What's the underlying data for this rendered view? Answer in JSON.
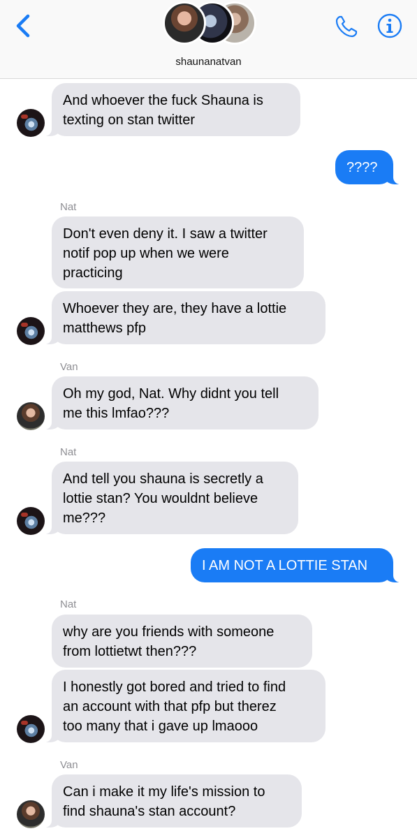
{
  "header": {
    "group_name": "shaunanatvan",
    "back_icon": "chevron-left-icon",
    "call_icon": "phone-icon",
    "details_icon": "info-icon",
    "accent": "#1a7cf5"
  },
  "colors": {
    "outgoing_bubble": "#1a7cf5",
    "incoming_bubble": "#e5e5ea",
    "sender_label": "#8e8e93"
  },
  "messages": [
    {
      "from": "Nat",
      "text": [
        "And whoever the fuck Shauna is",
        "texting on stan twitter"
      ]
    },
    {
      "from": "me",
      "text": [
        "????"
      ]
    },
    {
      "sender_label": "Nat"
    },
    {
      "from": "Nat",
      "text": [
        "Don't even deny it. I saw a twitter",
        "notif pop up when we were",
        "practicing"
      ]
    },
    {
      "from": "Nat",
      "text": [
        "Whoever they are, they have a lottie",
        "matthews pfp"
      ]
    },
    {
      "sender_label": "Van"
    },
    {
      "from": "Van",
      "text": [
        "Oh my god, Nat. Why didnt you tell",
        "me this lmfao???"
      ]
    },
    {
      "sender_label": "Nat"
    },
    {
      "from": "Nat",
      "text": [
        "And tell you shauna is secretly a",
        "lottie stan? You wouldnt believe",
        "me???"
      ]
    },
    {
      "from": "me",
      "text": [
        "I AM NOT A LOTTIE STAN"
      ]
    },
    {
      "sender_label": "Nat"
    },
    {
      "from": "Nat",
      "text": [
        "why are you friends with someone",
        "from lottietwt then???"
      ]
    },
    {
      "from": "Nat",
      "text": [
        "I honestly got bored and tried to find",
        "an account with that pfp but therez",
        "too many that i gave up lmaooo"
      ]
    },
    {
      "sender_label": "Van"
    },
    {
      "from": "Van",
      "text": [
        "Can i make it my life's mission to",
        "find shauna's stan account?"
      ]
    }
  ]
}
